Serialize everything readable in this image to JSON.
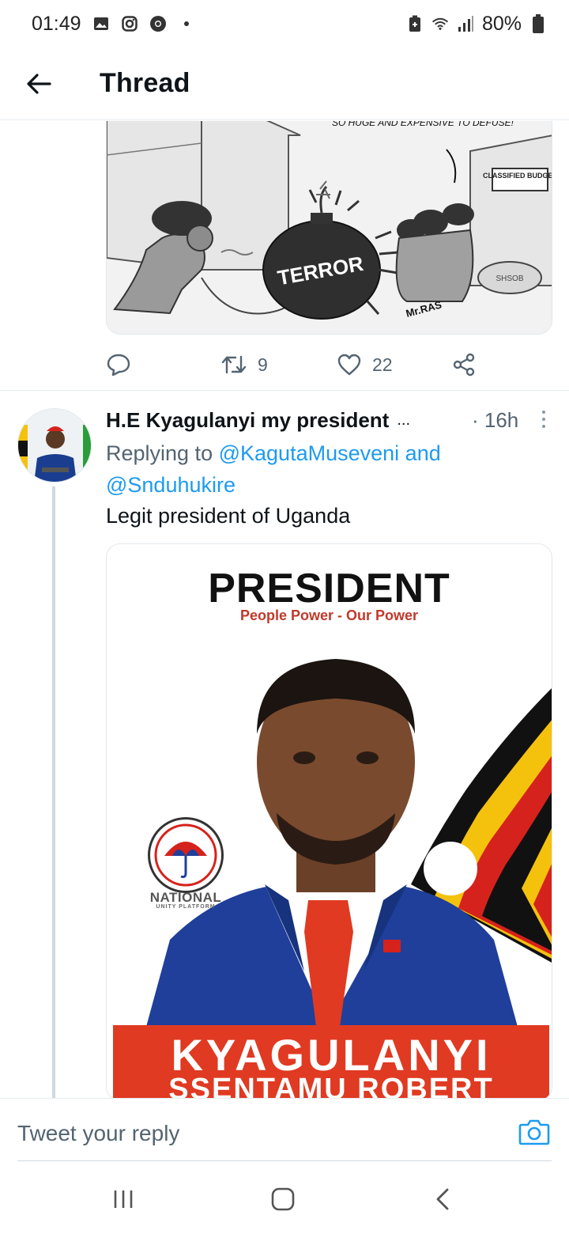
{
  "status_bar": {
    "time": "01:49",
    "battery": "80%",
    "icons": [
      "gallery-icon",
      "instagram-icon",
      "chrome-icon",
      "dot-icon",
      "battery-saver-icon",
      "wifi-icon",
      "signal-icon",
      "battery-icon"
    ]
  },
  "header": {
    "title": "Thread",
    "back_icon": "arrow-left-icon"
  },
  "first_tweet": {
    "image_description_labels": [
      "SO HUGE AND EXPENSIVE TO DEFUSE!",
      "CLASSIFIED BUDGET",
      "TERROR",
      "SHSOB",
      "Mr.RAS"
    ],
    "image_text": {
      "speech": "SO HUGE AND EXPENSIVE TO DEFUSE!",
      "sign": "CLASSIFIED BUDGET",
      "bomb": "TERROR",
      "bag": "SHSOB",
      "signature": "Mr.RAS"
    },
    "actions": {
      "reply_count": "",
      "retweet_count": "9",
      "like_count": "22"
    }
  },
  "second_tweet": {
    "author": "H.E Kyagulanyi my president",
    "author_truncation": "...",
    "time": "· 16h",
    "reply_prefix": "Replying to",
    "reply_mention_1": "@KagutaMuseveni",
    "reply_and": "and",
    "reply_mention_2": "@Snduhukire",
    "text": "Legit president of Uganda",
    "poster": {
      "title": "PRESIDENT",
      "subtitle": "People Power - Our Power",
      "party": "NATIONAL",
      "party_sub": "UNITY PLATFORM",
      "name_line1": "KYAGULANYI",
      "name_line2": "SSENTAMU ROBERT"
    }
  },
  "reply_bar": {
    "placeholder": "Tweet your reply",
    "camera_icon": "camera-icon"
  },
  "nav_bar": {
    "buttons": [
      "recent-apps-icon",
      "home-icon",
      "back-icon"
    ]
  },
  "colors": {
    "link": "#1d9bf0",
    "secondary_text": "#536471",
    "poster_red": "#e03a22"
  }
}
